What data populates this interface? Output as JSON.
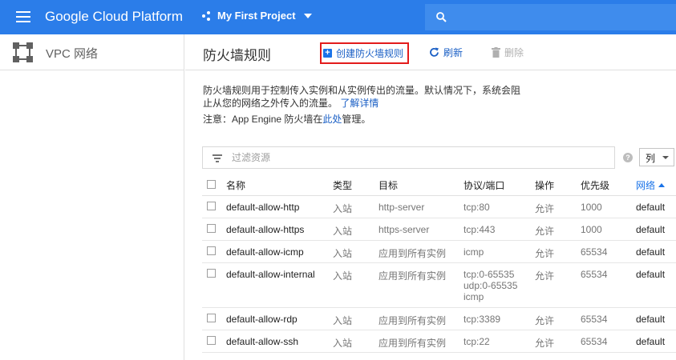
{
  "topbar": {
    "brand": "Google Cloud Platform",
    "project": "My First Project",
    "icons": [
      "menu-icon",
      "project-icon",
      "chevron-down-icon",
      "search-icon"
    ],
    "color": "#2b7de9"
  },
  "sidebar": {
    "title": "VPC 网络",
    "icon": "vpc-network-icon"
  },
  "header": {
    "title": "防火墙规则",
    "create_label": "创建防火墙规则",
    "refresh_label": "刷新",
    "delete_label": "删除"
  },
  "description": {
    "text": "防火墙规则用于控制传入实例和从实例传出的流量。默认情况下，系统会阻止从您的网络之外传入的流量。",
    "learn_more": "了解详情",
    "note_prefix": "注意：App Engine 防火墙在",
    "note_link": "此处",
    "note_suffix": "管理。"
  },
  "filter": {
    "placeholder": "过滤资源",
    "columns_label": "列"
  },
  "table": {
    "headers": {
      "name": "名称",
      "type": "类型",
      "target": "目标",
      "protocol": "协议/端口",
      "action": "操作",
      "priority": "优先级",
      "network": "网络"
    },
    "rows": [
      {
        "name": "default-allow-http",
        "type": "入站",
        "target": "http-server",
        "protocol": [
          "tcp:80"
        ],
        "action": "允许",
        "priority": "1000",
        "network": "default"
      },
      {
        "name": "default-allow-https",
        "type": "入站",
        "target": "https-server",
        "protocol": [
          "tcp:443"
        ],
        "action": "允许",
        "priority": "1000",
        "network": "default"
      },
      {
        "name": "default-allow-icmp",
        "type": "入站",
        "target": "应用到所有实例",
        "protocol": [
          "icmp"
        ],
        "action": "允许",
        "priority": "65534",
        "network": "default"
      },
      {
        "name": "default-allow-internal",
        "type": "入站",
        "target": "应用到所有实例",
        "protocol": [
          "tcp:0-65535",
          "udp:0-65535",
          "icmp"
        ],
        "action": "允许",
        "priority": "65534",
        "network": "default"
      },
      {
        "name": "default-allow-rdp",
        "type": "入站",
        "target": "应用到所有实例",
        "protocol": [
          "tcp:3389"
        ],
        "action": "允许",
        "priority": "65534",
        "network": "default"
      },
      {
        "name": "default-allow-ssh",
        "type": "入站",
        "target": "应用到所有实例",
        "protocol": [
          "tcp:22"
        ],
        "action": "允许",
        "priority": "65534",
        "network": "default"
      }
    ]
  }
}
